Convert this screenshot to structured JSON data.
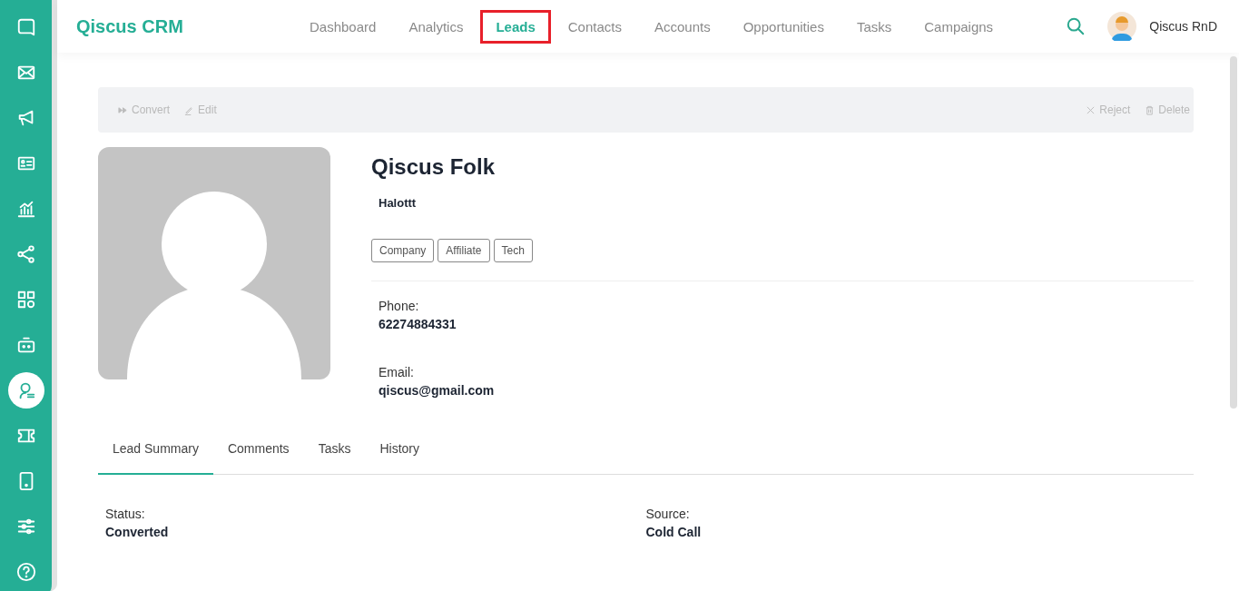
{
  "sidebar": {
    "items": [
      {
        "kind": "chat",
        "selected": false
      },
      {
        "kind": "mail",
        "selected": false
      },
      {
        "kind": "megaphone",
        "selected": false
      },
      {
        "kind": "card",
        "selected": false
      },
      {
        "kind": "chart",
        "selected": false
      },
      {
        "kind": "share",
        "selected": false
      },
      {
        "kind": "apps",
        "selected": false
      },
      {
        "kind": "robot",
        "selected": false
      },
      {
        "kind": "agent",
        "selected": true
      },
      {
        "kind": "ticket",
        "selected": false
      },
      {
        "kind": "phone",
        "selected": false
      },
      {
        "kind": "sliders",
        "selected": false
      },
      {
        "kind": "help",
        "selected": false
      }
    ]
  },
  "header": {
    "brand": "Qiscus CRM",
    "user": "Qiscus RnD"
  },
  "nav": [
    {
      "label": "Dashboard",
      "selected": false
    },
    {
      "label": "Analytics",
      "selected": false
    },
    {
      "label": "Leads",
      "selected": true
    },
    {
      "label": "Contacts",
      "selected": false
    },
    {
      "label": "Accounts",
      "selected": false
    },
    {
      "label": "Opportunities",
      "selected": false
    },
    {
      "label": "Tasks",
      "selected": false
    },
    {
      "label": "Campaigns",
      "selected": false
    }
  ],
  "actions": {
    "left": [
      {
        "kind": "convert",
        "label": "Convert"
      },
      {
        "kind": "edit",
        "label": "Edit"
      }
    ],
    "right": [
      {
        "kind": "reject",
        "label": "Reject"
      },
      {
        "kind": "delete",
        "label": "Delete"
      }
    ]
  },
  "lead": {
    "name": "Qiscus Folk",
    "subtitle": "Halottt",
    "tags": [
      "Company",
      "Affiliate",
      "Tech"
    ],
    "fields": [
      {
        "label": "Phone:",
        "value": "62274884331"
      },
      {
        "label": "Email:",
        "value": "qiscus@gmail.com"
      }
    ]
  },
  "tabs": [
    {
      "label": "Lead Summary",
      "selected": true
    },
    {
      "label": "Comments",
      "selected": false
    },
    {
      "label": "Tasks",
      "selected": false
    },
    {
      "label": "History",
      "selected": false
    }
  ],
  "summary": [
    {
      "label": "Status:",
      "value": "Converted"
    },
    {
      "label": "Source:",
      "value": "Cold Call"
    }
  ]
}
